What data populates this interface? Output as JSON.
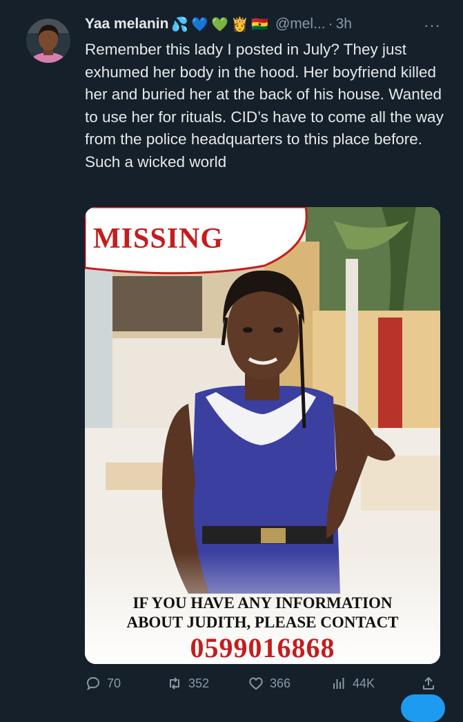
{
  "tweet": {
    "author_name": "Yaa melanin",
    "emojis": [
      "💦",
      "💙",
      "💚",
      "👸",
      "🇬🇭"
    ],
    "handle": "@mel...",
    "separator": "·",
    "time": "3h",
    "more": "···",
    "text": "Remember this lady I posted in July? They just exhumed her body in the hood. Her boyfriend killed her and buried her at the back of his house. Wanted to use her for rituals. CID’s have to come all the way from the police headquarters to this place before. Such a wicked world"
  },
  "poster": {
    "headline": "MISSING",
    "caption_line1": "IF YOU HAVE ANY INFORMATION",
    "caption_line2": "ABOUT JUDITH, PLEASE CONTACT",
    "phone": "0599016868"
  },
  "actions": {
    "replies": "70",
    "retweets": "352",
    "likes": "366",
    "views": "44K"
  },
  "icons": {
    "reply": "reply-icon",
    "retweet": "retweet-icon",
    "like": "heart-icon",
    "views": "views-icon",
    "share": "share-icon"
  },
  "colors": {
    "background": "#15202b",
    "text": "#e7e9ea",
    "muted": "#8b98a5",
    "poster_red": "#c41d1d",
    "accent": "#1d9bf0"
  }
}
